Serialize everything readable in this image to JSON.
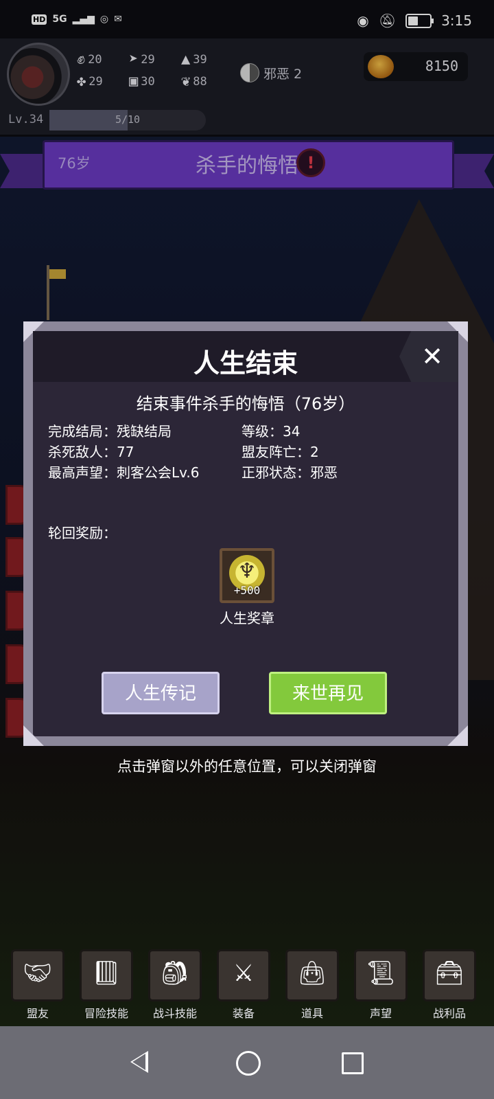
{
  "status_bar": {
    "hd": "HD",
    "network": "5G",
    "time": "3:15"
  },
  "hud": {
    "stats": [
      {
        "icon": "fist-icon",
        "value": "20"
      },
      {
        "icon": "clover-icon",
        "value": "29"
      },
      {
        "icon": "boot-icon",
        "value": "29"
      },
      {
        "icon": "armor-icon",
        "value": "30"
      },
      {
        "icon": "wizard-hat-icon",
        "value": "39"
      },
      {
        "icon": "lotus-icon",
        "value": "88"
      }
    ],
    "alignment_label": "邪恶 2",
    "gold": "8150",
    "level": "Lv.34",
    "xp_text": "5/10",
    "xp_fraction": 0.5
  },
  "ribbon": {
    "age": "76岁",
    "event_title": "杀手的悔悟"
  },
  "dialog": {
    "title": "人生结束",
    "subtitle": "结束事件杀手的悔悟（76岁）",
    "info_left": [
      "完成结局：残缺结局",
      "杀死敌人：77",
      "最高声望：刺客公会Lv.6"
    ],
    "info_right": [
      "等级：34",
      "盟友阵亡：2",
      "正邪状态：邪恶"
    ],
    "reward_label": "轮回奖励：",
    "reward": {
      "amount": "+500",
      "name": "人生奖章"
    },
    "button_biography": "人生传记",
    "button_next_life": "来世再见"
  },
  "hint": "点击弹窗以外的任意位置，可以关闭弹窗",
  "bottom_nav": [
    {
      "label": "盟友",
      "icon": "handshake-icon"
    },
    {
      "label": "冒险技能",
      "icon": "book-icon"
    },
    {
      "label": "战斗技能",
      "icon": "backpack-icon"
    },
    {
      "label": "装备",
      "icon": "crossed-swords-icon"
    },
    {
      "label": "道具",
      "icon": "satchel-icon"
    },
    {
      "label": "声望",
      "icon": "scroll-icon"
    },
    {
      "label": "战利品",
      "icon": "treasure-chest-icon"
    }
  ]
}
